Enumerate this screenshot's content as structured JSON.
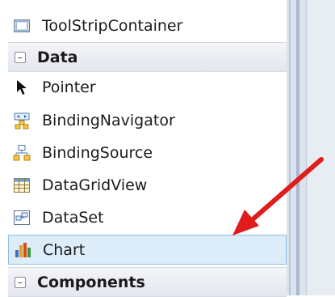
{
  "toolbox": {
    "items": [
      {
        "kind": "item",
        "label": "ToolStripContainer",
        "icon": "toolstrip-container-icon"
      },
      {
        "kind": "category",
        "label": "Data",
        "toggle": "⊟"
      },
      {
        "kind": "item",
        "label": "Pointer",
        "icon": "pointer-icon"
      },
      {
        "kind": "item",
        "label": "BindingNavigator",
        "icon": "binding-navigator-icon"
      },
      {
        "kind": "item",
        "label": "BindingSource",
        "icon": "binding-source-icon"
      },
      {
        "kind": "item",
        "label": "DataGridView",
        "icon": "datagridview-icon"
      },
      {
        "kind": "item",
        "label": "DataSet",
        "icon": "dataset-icon"
      },
      {
        "kind": "item",
        "label": "Chart",
        "icon": "chart-icon",
        "selected": true
      },
      {
        "kind": "category",
        "label": "Components",
        "toggle": "⊟"
      }
    ]
  },
  "colors": {
    "selected_bg": "#dcedf9",
    "selected_border": "#8ec1e6",
    "arrow": "#e01c1c"
  }
}
